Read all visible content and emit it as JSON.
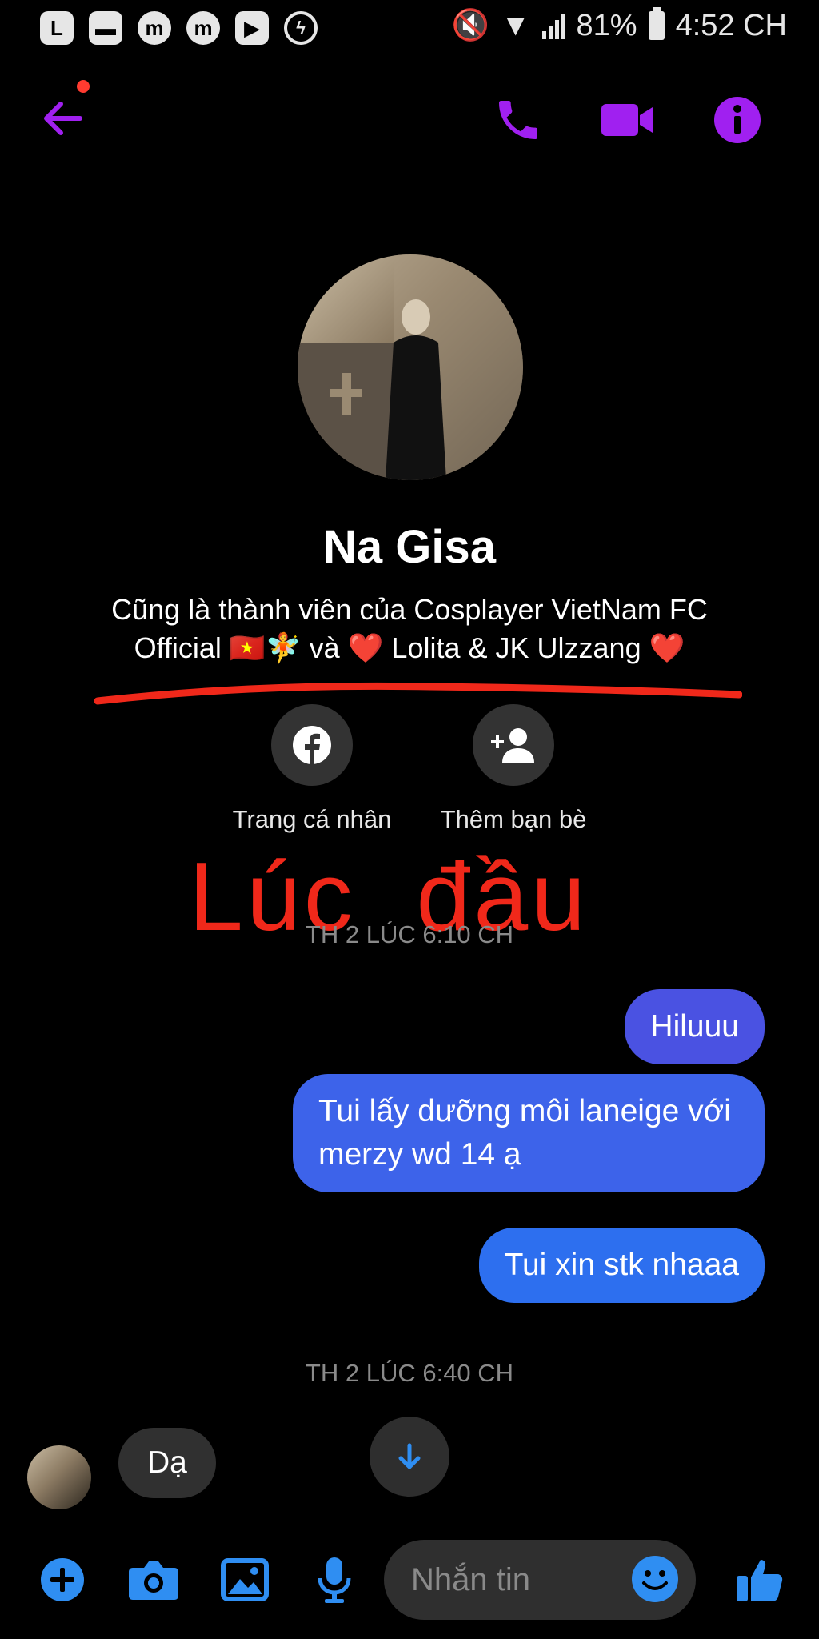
{
  "status_bar": {
    "app_icons": [
      "L",
      "book",
      "m",
      "m",
      "play",
      "messenger"
    ],
    "battery": "81%",
    "time": "4:52 CH"
  },
  "header": {
    "accent_color": "#a020f0",
    "icons": [
      "back-arrow-icon",
      "phone-icon",
      "video-camera-icon",
      "info-icon"
    ]
  },
  "profile": {
    "name": "Na Gisa",
    "description_line1": "Cũng là thành viên của Cosplayer VietNam FC",
    "description_line2": "Official 🇻🇳🧚 và ❤️ Lolita & JK Ulzzang ❤️",
    "actions": [
      {
        "label": "Trang cá nhân",
        "icon": "facebook-icon"
      },
      {
        "label": "Thêm bạn bè",
        "icon": "add-friend-icon"
      }
    ]
  },
  "annotation": {
    "text": "Lúc  đầu",
    "color": "#f0281a"
  },
  "conversation": {
    "timestamp_1": "TH 2 LÚC 6:10 CH",
    "sent_messages": [
      "Hiluuu",
      "Tui lấy dưỡng môi laneige với merzy wd 14 ạ",
      "Tui xin stk nhaaa"
    ],
    "timestamp_2": "TH 2 LÚC 6:40 CH",
    "received_message": "Dạ"
  },
  "composer": {
    "placeholder": "Nhắn tin",
    "accent_color": "#2f8ef2",
    "icons": [
      "plus-icon",
      "camera-icon",
      "image-icon",
      "microphone-icon",
      "emoji-icon",
      "thumbs-up-icon"
    ]
  }
}
